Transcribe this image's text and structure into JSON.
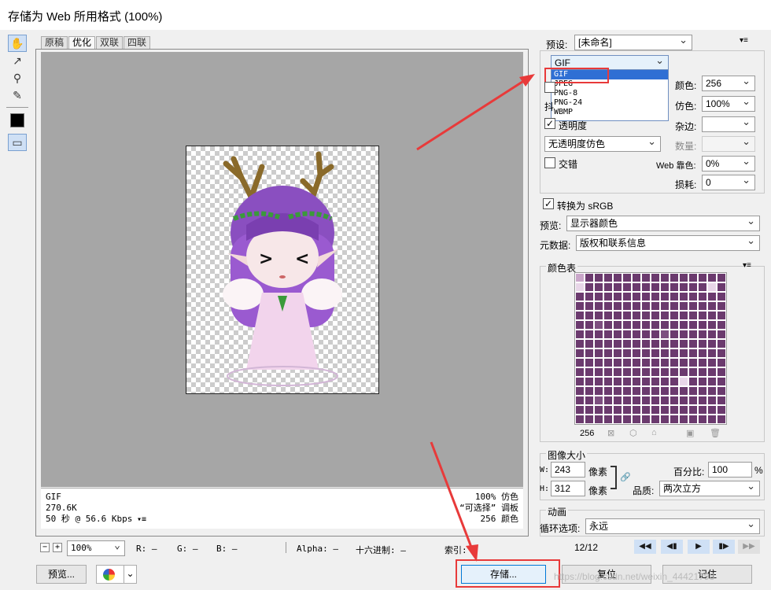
{
  "window": {
    "title": "存储为 Web 所用格式 (100%)"
  },
  "tabs": [
    "原稿",
    "优化",
    "双联",
    "四联"
  ],
  "image_info": {
    "format": "GIF",
    "size": "270.6K",
    "time": "50 秒 @ 56.6 Kbps",
    "dither": "100% 仿色",
    "palette": "“可选择” 调板",
    "colors": "256 颜色"
  },
  "status": {
    "zoom": "100%",
    "r": "R: —",
    "g": "G: —",
    "b": "B: —",
    "alpha": "Alpha: —",
    "hex": "十六进制: —",
    "index": "索引: —"
  },
  "buttons": {
    "preview": "预览...",
    "save": "存储...",
    "reset": "复位",
    "remember": "记住"
  },
  "settings": {
    "preset_label": "预设:",
    "preset_value": "[未命名]",
    "format_value": "GIF",
    "format_options": [
      "GIF",
      "JPEG",
      "PNG-8",
      "PNG-24",
      "WBMP"
    ],
    "colors_label": "颜色:",
    "colors_value": "256",
    "dither_label": "仿色:",
    "dither_value": "100%",
    "matte_label": "杂边:",
    "transparency_label": "透明度",
    "transparency_dither_value": "无透明度仿色",
    "amount_label": "数量:",
    "interlaced_label": "交错",
    "web_snap_label": "Web 靠色:",
    "web_snap_value": "0%",
    "lossy_label": "损耗:",
    "lossy_value": "0",
    "convert_srgb_label": "转换为 sRGB",
    "preview_label": "预览:",
    "preview_value": "显示器颜色",
    "metadata_label": "元数据:",
    "metadata_value": "版权和联系信息"
  },
  "color_table": {
    "title": "颜色表",
    "count": "256"
  },
  "image_size": {
    "title": "图像大小",
    "w_label": "W:",
    "w_value": "243",
    "h_label": "H:",
    "h_value": "312",
    "unit": "像素",
    "percent_label": "百分比:",
    "percent_value": "100",
    "percent_unit": "%",
    "quality_label": "品质:",
    "quality_value": "两次立方"
  },
  "animation": {
    "title": "动画",
    "loop_label": "循环选项:",
    "loop_value": "永远",
    "frame": "12/12"
  },
  "watermark": "https://blog.csdn.net/weixin_44421798",
  "colors": {
    "accent_blue": "#2f6fd4",
    "highlight_red": "#e83a3a",
    "canvas_gray": "#a6a6a6"
  }
}
